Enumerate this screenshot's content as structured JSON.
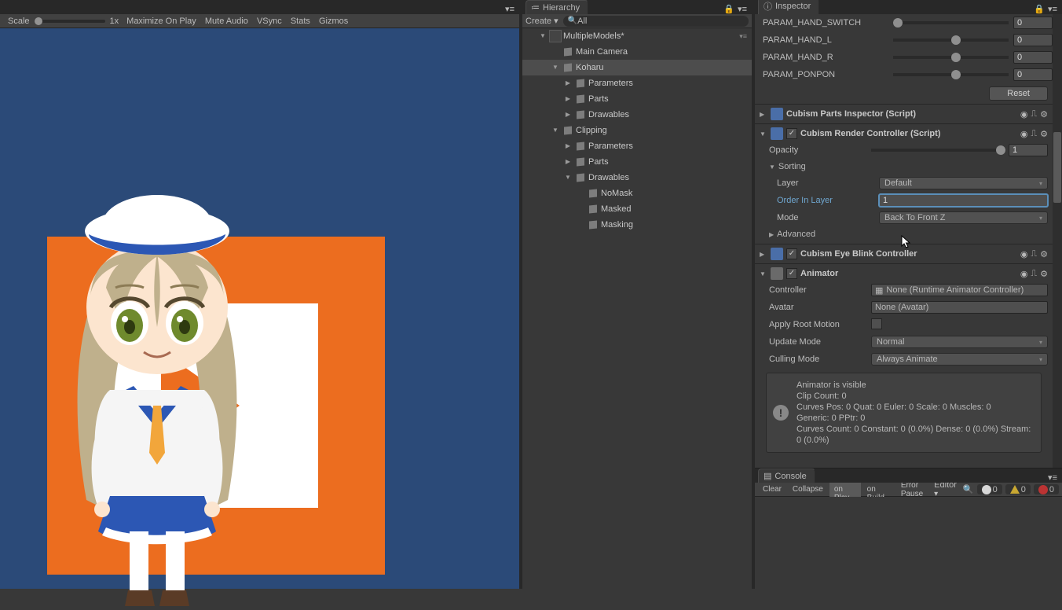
{
  "gamebar": {
    "scale_label": "Scale",
    "scale_val": "1x",
    "maximize": "Maximize On Play",
    "mute": "Mute Audio",
    "vsync": "VSync",
    "stats": "Stats",
    "gizmos": "Gizmos"
  },
  "hierarchy": {
    "tab": "Hierarchy",
    "create": "Create",
    "search_placeholder": "All",
    "scene": "MultipleModels*",
    "items": [
      {
        "name": "Main Camera",
        "indent": 2,
        "fold": ""
      },
      {
        "name": "Koharu",
        "indent": 2,
        "fold": "▼",
        "sel": true
      },
      {
        "name": "Parameters",
        "indent": 3,
        "fold": "▶"
      },
      {
        "name": "Parts",
        "indent": 3,
        "fold": "▶"
      },
      {
        "name": "Drawables",
        "indent": 3,
        "fold": "▶"
      },
      {
        "name": "Clipping",
        "indent": 2,
        "fold": "▼"
      },
      {
        "name": "Parameters",
        "indent": 3,
        "fold": "▶"
      },
      {
        "name": "Parts",
        "indent": 3,
        "fold": "▶"
      },
      {
        "name": "Drawables",
        "indent": 3,
        "fold": "▼"
      },
      {
        "name": "NoMask",
        "indent": 4,
        "fold": ""
      },
      {
        "name": "Masked",
        "indent": 4,
        "fold": ""
      },
      {
        "name": "Masking",
        "indent": 4,
        "fold": ""
      }
    ]
  },
  "inspector": {
    "tab": "Inspector",
    "params": [
      {
        "name": "PARAM_HAND_SWITCH",
        "val": "0",
        "knob": 0
      },
      {
        "name": "PARAM_HAND_L",
        "val": "0",
        "knob": 50
      },
      {
        "name": "PARAM_HAND_R",
        "val": "0",
        "knob": 50
      },
      {
        "name": "PARAM_PONPON",
        "val": "0",
        "knob": 50
      }
    ],
    "reset": "Reset",
    "comp_parts": "Cubism Parts Inspector (Script)",
    "comp_render": {
      "title": "Cubism Render Controller (Script)",
      "opacity_label": "Opacity",
      "opacity_val": "1",
      "sorting_label": "Sorting",
      "layer_label": "Layer",
      "layer_val": "Default",
      "order_label": "Order In Layer",
      "order_val": "1",
      "mode_label": "Mode",
      "mode_val": "Back To Front Z",
      "advanced_label": "Advanced"
    },
    "comp_eye": "Cubism Eye Blink Controller",
    "comp_anim": {
      "title": "Animator",
      "controller_label": "Controller",
      "controller_val": "None (Runtime Animator Controller)",
      "avatar_label": "Avatar",
      "avatar_val": "None (Avatar)",
      "root_label": "Apply Root Motion",
      "update_label": "Update Mode",
      "update_val": "Normal",
      "culling_label": "Culling Mode",
      "culling_val": "Always Animate",
      "info": [
        "Animator is visible",
        "Clip Count: 0",
        "Curves Pos: 0 Quat: 0 Euler: 0 Scale: 0 Muscles: 0",
        "Generic: 0 PPtr: 0",
        "Curves Count: 0 Constant: 0 (0.0%) Dense: 0 (0.0%) Stream: 0 (0.0%)"
      ]
    }
  },
  "console": {
    "tab": "Console",
    "clear": "Clear",
    "collapse": "Collapse",
    "clear_play": "Clear on Play",
    "clear_build": "Clear on Build",
    "error_pause": "Error Pause",
    "editor": "Editor",
    "c_info": "0",
    "c_warn": "0",
    "c_err": "0"
  }
}
